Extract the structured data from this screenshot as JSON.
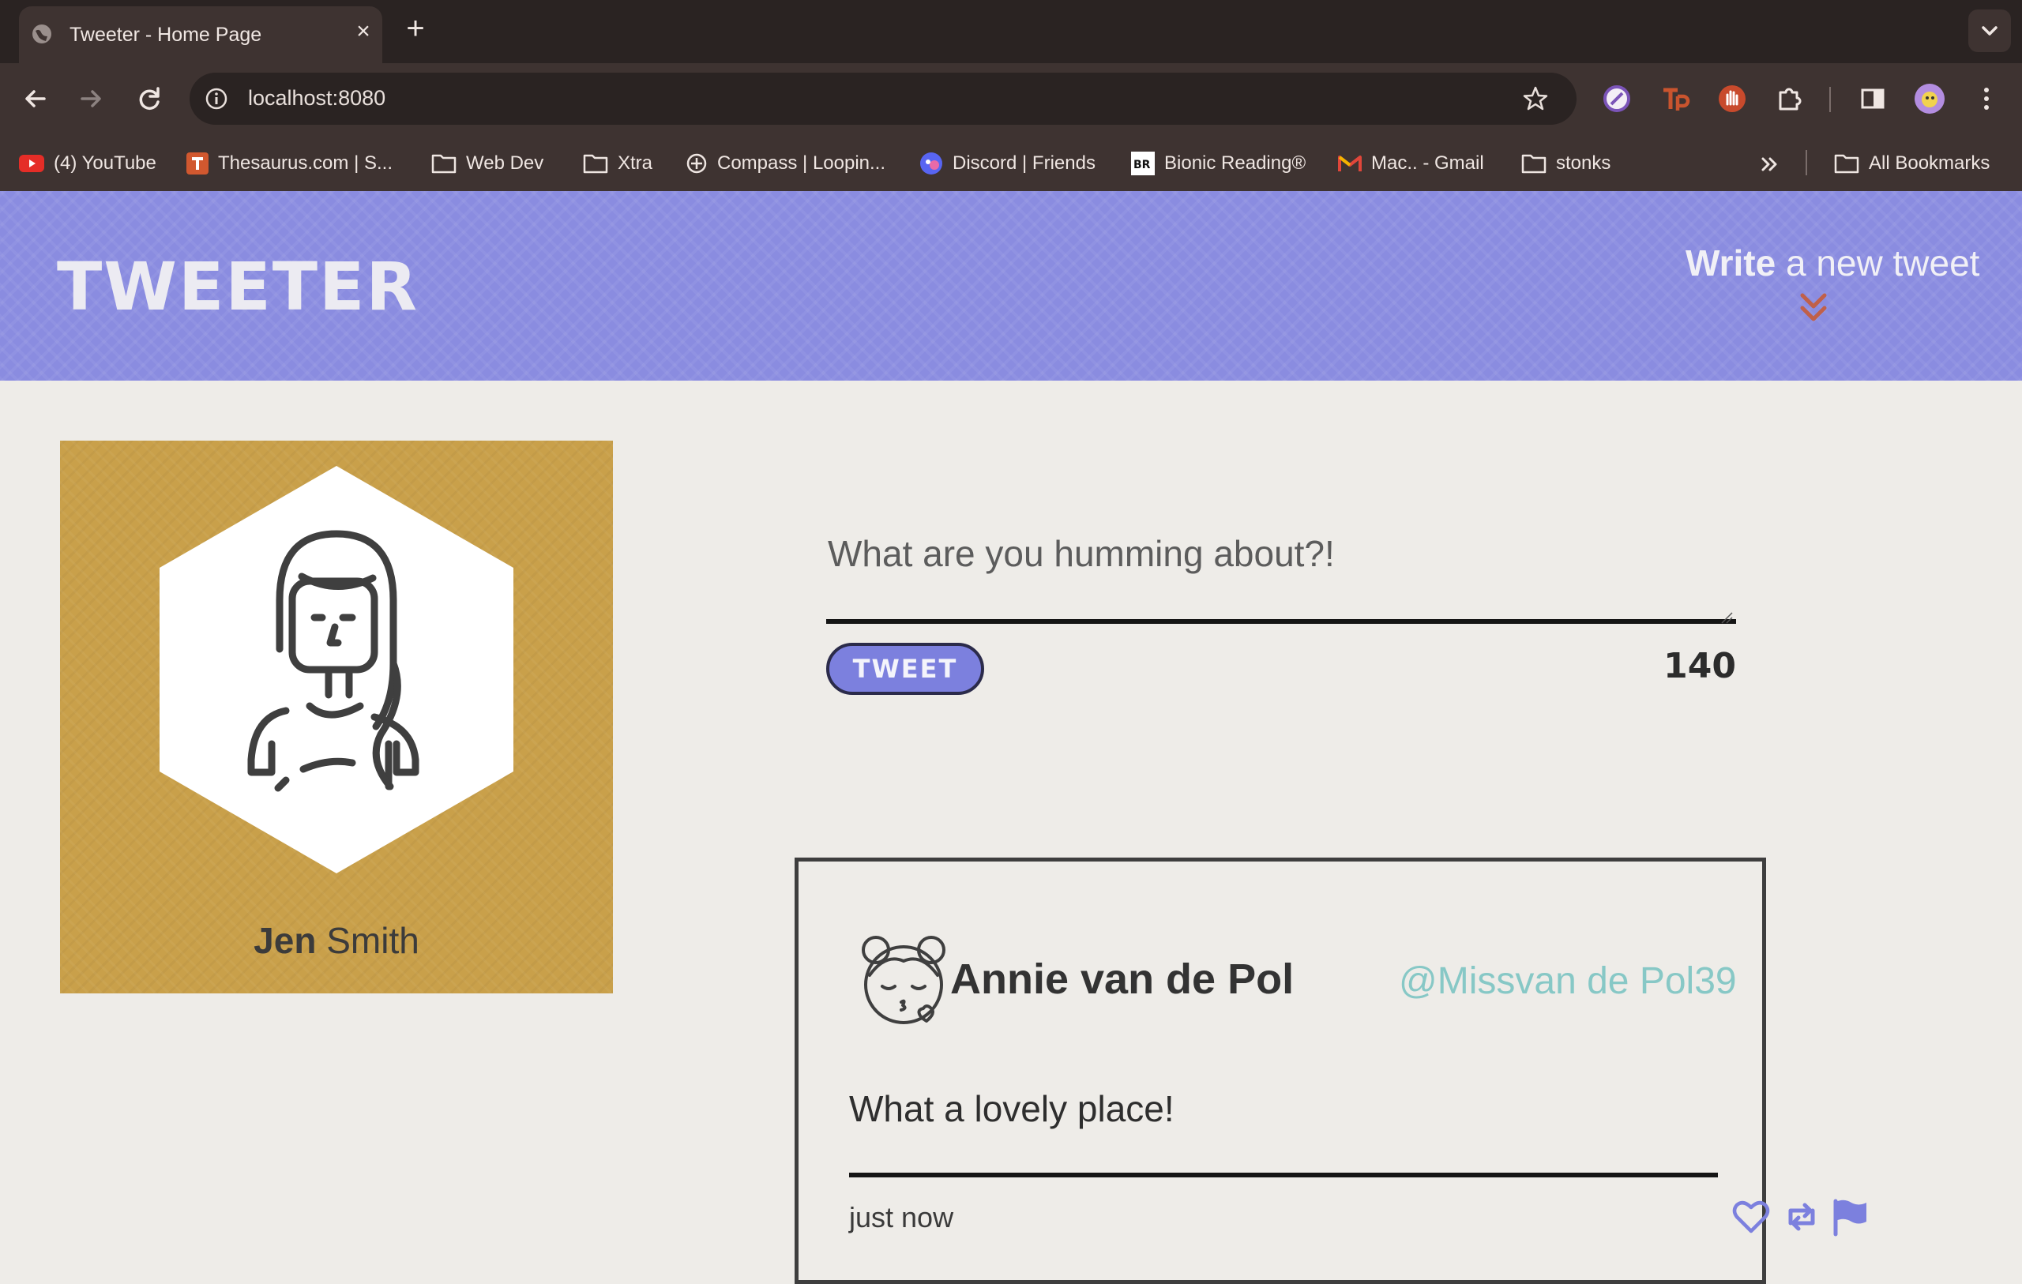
{
  "browser": {
    "tab": {
      "title": "Tweeter - Home Page"
    },
    "address": "localhost:8080",
    "bookmarks": [
      {
        "label": "(4) YouTube"
      },
      {
        "label": "Thesaurus.com | S..."
      },
      {
        "label": "Web Dev"
      },
      {
        "label": "Xtra"
      },
      {
        "label": "Compass | Loopin..."
      },
      {
        "label": "Discord | Friends"
      },
      {
        "label": "Bionic Reading®"
      },
      {
        "label": "Mac.. - Gmail"
      },
      {
        "label": "stonks"
      }
    ],
    "all_bookmarks": "All Bookmarks"
  },
  "header": {
    "logo": "TWEETER",
    "write_bold": "Write",
    "write_rest": "a new tweet"
  },
  "profile": {
    "first": "Jen",
    "last": "Smith"
  },
  "composer": {
    "placeholder": "What are you humming about?!",
    "button": "TWEET",
    "counter": "140"
  },
  "tweet": {
    "name": "Annie van de Pol",
    "handle": "@Missvan de Pol39",
    "body": "What a lovely place!",
    "time": "just now"
  },
  "colors": {
    "header_bg": "#8a8ce0",
    "profile_bg": "#c9a04a",
    "accent": "#7c80de",
    "handle": "#87c8c6",
    "arrow": "#c0604a"
  }
}
